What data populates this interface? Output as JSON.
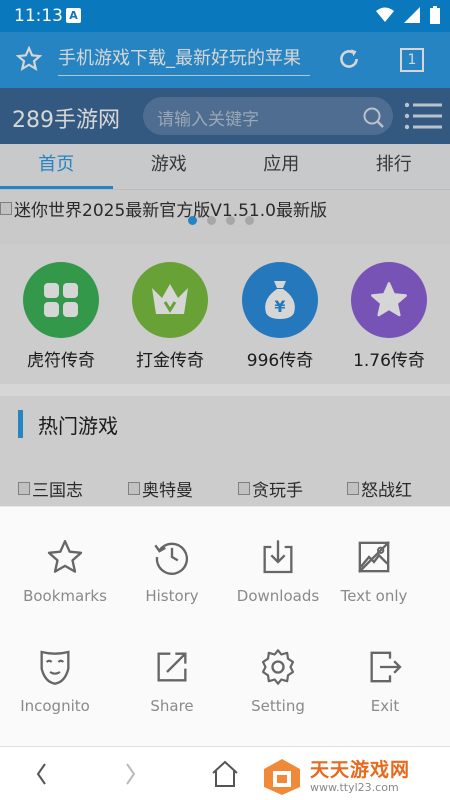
{
  "status": {
    "time": "11:13",
    "notification_letter": "A"
  },
  "browser": {
    "url_title": "手机游戏下载_最新好玩的苹果",
    "tab_count": "1"
  },
  "site": {
    "logo": "289手游网",
    "search_placeholder": "请输入关键字"
  },
  "nav": {
    "tabs": [
      {
        "label": "首页"
      },
      {
        "label": "游戏"
      },
      {
        "label": "应用"
      },
      {
        "label": "排行"
      }
    ]
  },
  "banner": {
    "alt_text": "迷你世界2025最新官方版V1.51.0最新版",
    "dot_count": 4,
    "active_dot": 0
  },
  "quick_links": [
    {
      "label": "虎符传奇",
      "icon": "grid-icon",
      "color": "#3fb55a"
    },
    {
      "label": "打金传奇",
      "icon": "crown-icon",
      "color": "#7cc142"
    },
    {
      "label": "996传奇",
      "icon": "money-bag-icon",
      "color": "#2e8fe0"
    },
    {
      "label": "1.76传奇",
      "icon": "star-icon",
      "color": "#8e63d8"
    }
  ],
  "hot": {
    "title": "热门游戏",
    "games": [
      {
        "label": "三国志"
      },
      {
        "label": "奥特曼"
      },
      {
        "label": "贪玩手"
      },
      {
        "label": "怒战红"
      }
    ]
  },
  "menu": {
    "items": [
      {
        "label": "Bookmarks",
        "icon": "star-outline-icon"
      },
      {
        "label": "History",
        "icon": "clock-icon"
      },
      {
        "label": "Downloads",
        "icon": "download-icon"
      },
      {
        "label": "Text only",
        "icon": "image-off-icon"
      },
      {
        "label": "Incognito",
        "icon": "mask-icon"
      },
      {
        "label": "Share",
        "icon": "share-icon"
      },
      {
        "label": "Setting",
        "icon": "gear-icon"
      },
      {
        "label": "Exit",
        "icon": "exit-icon"
      }
    ]
  },
  "watermark": {
    "title": "天天游戏网",
    "url": "www.ttyl23.com"
  }
}
